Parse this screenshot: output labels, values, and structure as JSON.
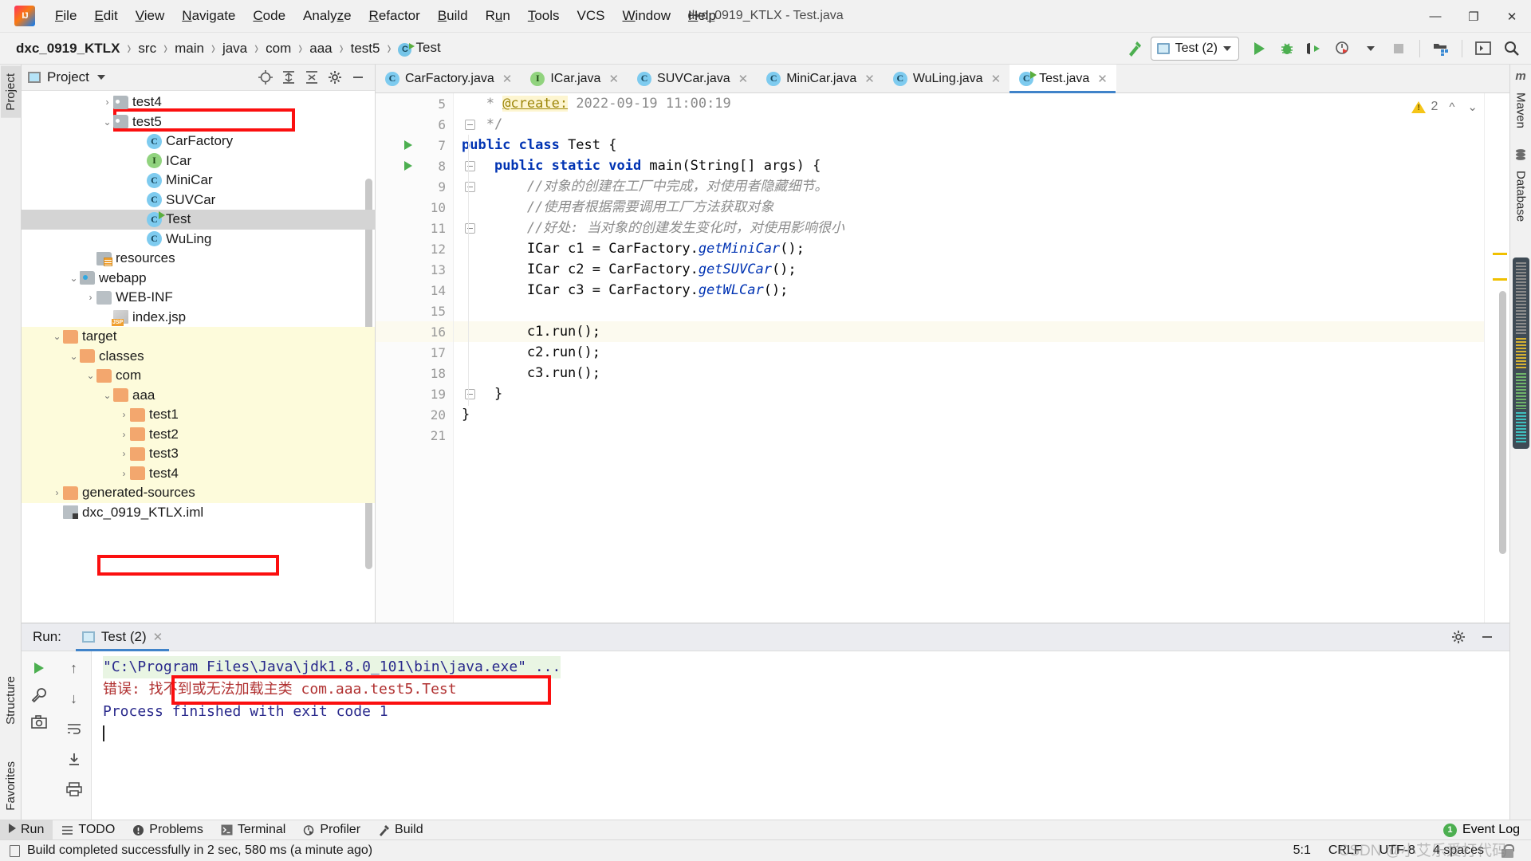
{
  "window": {
    "title": "dxc_0919_KTLX - Test.java",
    "minimize": "—",
    "maximize": "❐",
    "close": "✕"
  },
  "menubar": [
    {
      "label": "File",
      "mnemonic": "F"
    },
    {
      "label": "Edit",
      "mnemonic": "E"
    },
    {
      "label": "View",
      "mnemonic": "V"
    },
    {
      "label": "Navigate",
      "mnemonic": "N"
    },
    {
      "label": "Code",
      "mnemonic": "C"
    },
    {
      "label": "Analyze",
      "mnemonic": "z"
    },
    {
      "label": "Refactor",
      "mnemonic": "R"
    },
    {
      "label": "Build",
      "mnemonic": "B"
    },
    {
      "label": "Run",
      "mnemonic": "u"
    },
    {
      "label": "Tools",
      "mnemonic": "T"
    },
    {
      "label": "VCS",
      "mnemonic": ""
    },
    {
      "label": "Window",
      "mnemonic": "W"
    },
    {
      "label": "Help",
      "mnemonic": "H"
    }
  ],
  "breadcrumb": {
    "items": [
      "dxc_0919_KTLX",
      "src",
      "main",
      "java",
      "com",
      "aaa",
      "test5",
      "Test"
    ],
    "separator": "›",
    "last_icon": "class-icon"
  },
  "toolbar": {
    "build_hammer": "build-icon",
    "run_config": "Test (2)",
    "run": "run-icon",
    "debug": "debug-icon",
    "run_coverage": "run-with-coverage-icon",
    "profile": "profiler-icon",
    "stop": "stop-icon",
    "project_structure": "project-structure-icon",
    "terminal": "terminal-icon",
    "search": "search-everywhere-icon"
  },
  "left_strip": {
    "tabs": [
      {
        "label": "Project",
        "active": true
      },
      {
        "label": "Structure",
        "active": false
      },
      {
        "label": "Favorites",
        "active": false
      }
    ]
  },
  "right_strip": {
    "tabs": [
      {
        "label": "Maven",
        "icon": "maven-icon"
      },
      {
        "label": "Database",
        "icon": "database-icon"
      }
    ]
  },
  "project_panel": {
    "title": "Project",
    "actions": [
      "locate-icon",
      "expand-all-icon",
      "collapse-all-icon",
      "settings-icon",
      "hide-icon"
    ],
    "tree": [
      {
        "label": "test4",
        "indent": 4,
        "arrow": "collapsed",
        "icon": "folder-source",
        "type": "folder"
      },
      {
        "label": "test5",
        "indent": 4,
        "arrow": "expanded",
        "icon": "folder-source",
        "type": "folder",
        "boxed": true
      },
      {
        "label": "CarFactory",
        "indent": 6,
        "arrow": "none",
        "icon": "class",
        "type": "class"
      },
      {
        "label": "ICar",
        "indent": 6,
        "arrow": "none",
        "icon": "interface",
        "type": "interface"
      },
      {
        "label": "MiniCar",
        "indent": 6,
        "arrow": "none",
        "icon": "class",
        "type": "class"
      },
      {
        "label": "SUVCar",
        "indent": 6,
        "arrow": "none",
        "icon": "class",
        "type": "class"
      },
      {
        "label": "Test",
        "indent": 6,
        "arrow": "none",
        "icon": "class-runnable",
        "type": "class",
        "selected": true
      },
      {
        "label": "WuLing",
        "indent": 6,
        "arrow": "none",
        "icon": "class",
        "type": "class"
      },
      {
        "label": "resources",
        "indent": 3,
        "arrow": "none",
        "icon": "folder-resources",
        "type": "folder"
      },
      {
        "label": "webapp",
        "indent": 2,
        "arrow": "expanded",
        "icon": "folder-web",
        "type": "folder"
      },
      {
        "label": "WEB-INF",
        "indent": 3,
        "arrow": "collapsed",
        "icon": "folder-plain",
        "type": "folder"
      },
      {
        "label": "index.jsp",
        "indent": 4,
        "arrow": "none",
        "icon": "jsp",
        "type": "file"
      },
      {
        "label": "target",
        "indent": 1,
        "arrow": "expanded",
        "icon": "folder-excluded",
        "type": "folder",
        "highlight": true
      },
      {
        "label": "classes",
        "indent": 2,
        "arrow": "expanded",
        "icon": "folder-excluded",
        "type": "folder",
        "highlight": true
      },
      {
        "label": "com",
        "indent": 3,
        "arrow": "expanded",
        "icon": "folder-excluded",
        "type": "folder",
        "highlight": true
      },
      {
        "label": "aaa",
        "indent": 4,
        "arrow": "expanded",
        "icon": "folder-excluded",
        "type": "folder",
        "highlight": true
      },
      {
        "label": "test1",
        "indent": 5,
        "arrow": "collapsed",
        "icon": "folder-excluded",
        "type": "folder",
        "highlight": true
      },
      {
        "label": "test2",
        "indent": 5,
        "arrow": "collapsed",
        "icon": "folder-excluded",
        "type": "folder",
        "highlight": true
      },
      {
        "label": "test3",
        "indent": 5,
        "arrow": "collapsed",
        "icon": "folder-excluded",
        "type": "folder",
        "highlight": true
      },
      {
        "label": "test4",
        "indent": 5,
        "arrow": "collapsed",
        "icon": "folder-excluded",
        "type": "folder",
        "highlight": true
      },
      {
        "label": "generated-sources",
        "indent": 1,
        "arrow": "collapsed",
        "icon": "folder-excluded",
        "type": "folder",
        "highlight": true,
        "boxed": true
      },
      {
        "label": "dxc_0919_KTLX.iml",
        "indent": 1,
        "arrow": "none",
        "icon": "iml",
        "type": "file"
      }
    ]
  },
  "editor": {
    "tabs": [
      {
        "label": "CarFactory.java",
        "icon": "class",
        "active": false
      },
      {
        "label": "ICar.java",
        "icon": "interface",
        "active": false
      },
      {
        "label": "SUVCar.java",
        "icon": "class",
        "active": false
      },
      {
        "label": "MiniCar.java",
        "icon": "class",
        "active": false
      },
      {
        "label": "WuLing.java",
        "icon": "class",
        "active": false
      },
      {
        "label": "Test.java",
        "icon": "class-runnable",
        "active": true
      }
    ],
    "warning_count": "2",
    "lines": [
      {
        "no": "5",
        "tokens": [
          {
            "t": "cmjd",
            "v": "   * "
          },
          {
            "t": "tag-at",
            "v": "@create:"
          },
          {
            "t": "cmjd",
            "v": " 2022-09-19 11:00:19"
          }
        ],
        "run": false,
        "fold": false,
        "current": false
      },
      {
        "no": "6",
        "tokens": [
          {
            "t": "cmjd",
            "v": "   */"
          }
        ],
        "run": false,
        "fold": true,
        "current": false
      },
      {
        "no": "7",
        "tokens": [
          {
            "t": "kw",
            "v": "public class "
          },
          {
            "t": "plain",
            "v": "Test {"
          }
        ],
        "run": true,
        "fold": false,
        "current": false
      },
      {
        "no": "8",
        "tokens": [
          {
            "t": "plain",
            "v": "    "
          },
          {
            "t": "kw",
            "v": "public static void "
          },
          {
            "t": "plain",
            "v": "main(String[] args) {"
          }
        ],
        "run": true,
        "fold": true,
        "current": false
      },
      {
        "no": "9",
        "tokens": [
          {
            "t": "cm",
            "v": "        //对象的创建在工厂中完成，对使用者隐藏细节。"
          }
        ],
        "run": false,
        "fold": true,
        "current": false
      },
      {
        "no": "10",
        "tokens": [
          {
            "t": "cm",
            "v": "        //使用者根据需要调用工厂方法获取对象"
          }
        ],
        "run": false,
        "fold": false,
        "current": false
      },
      {
        "no": "11",
        "tokens": [
          {
            "t": "cm",
            "v": "        //好处: 当对象的创建发生变化时，对使用影响很小"
          }
        ],
        "run": false,
        "fold": true,
        "current": false
      },
      {
        "no": "12",
        "tokens": [
          {
            "t": "plain",
            "v": "        ICar c1 = CarFactory."
          },
          {
            "t": "mi",
            "v": "getMiniCar"
          },
          {
            "t": "plain",
            "v": "();"
          }
        ],
        "run": false,
        "fold": false,
        "current": false
      },
      {
        "no": "13",
        "tokens": [
          {
            "t": "plain",
            "v": "        ICar c2 = CarFactory."
          },
          {
            "t": "mi",
            "v": "getSUVCar"
          },
          {
            "t": "plain",
            "v": "();"
          }
        ],
        "run": false,
        "fold": false,
        "current": false
      },
      {
        "no": "14",
        "tokens": [
          {
            "t": "plain",
            "v": "        ICar c3 = CarFactory."
          },
          {
            "t": "mi",
            "v": "getWLCar"
          },
          {
            "t": "plain",
            "v": "();"
          }
        ],
        "run": false,
        "fold": false,
        "current": false
      },
      {
        "no": "15",
        "tokens": [
          {
            "t": "plain",
            "v": ""
          }
        ],
        "run": false,
        "fold": false,
        "current": false
      },
      {
        "no": "16",
        "tokens": [
          {
            "t": "plain",
            "v": "        c1.run();"
          }
        ],
        "run": false,
        "fold": false,
        "current": true
      },
      {
        "no": "17",
        "tokens": [
          {
            "t": "plain",
            "v": "        c2.run();"
          }
        ],
        "run": false,
        "fold": false,
        "current": false
      },
      {
        "no": "18",
        "tokens": [
          {
            "t": "plain",
            "v": "        c3.run();"
          }
        ],
        "run": false,
        "fold": false,
        "current": false
      },
      {
        "no": "19",
        "tokens": [
          {
            "t": "plain",
            "v": "    }"
          }
        ],
        "run": false,
        "fold": true,
        "current": false
      },
      {
        "no": "20",
        "tokens": [
          {
            "t": "plain",
            "v": "}"
          }
        ],
        "run": false,
        "fold": false,
        "current": false
      },
      {
        "no": "21",
        "tokens": [
          {
            "t": "plain",
            "v": ""
          }
        ],
        "run": false,
        "fold": false,
        "current": false
      }
    ]
  },
  "run_panel": {
    "label": "Run:",
    "tab": "Test (2)",
    "close": "✕",
    "actions": [
      "settings-icon",
      "hide-icon"
    ],
    "toolbar": [
      "rerun-icon",
      "wrench-icon",
      "camera-icon"
    ],
    "toolbar2": [
      "scroll-up-icon",
      "scroll-down-icon",
      "soft-wrap-icon",
      "scroll-to-end-icon",
      "print-icon"
    ],
    "console": [
      {
        "text": "\"C:\\Program Files\\Java\\jdk1.8.0_101\\bin\\java.exe\" ...",
        "style": "cmd"
      },
      {
        "text": "错误: 找不到或无法加载主类 com.aaa.test5.Test",
        "style": "err",
        "boxed": true
      },
      {
        "text": "",
        "style": "plain"
      },
      {
        "text": "Process finished with exit code 1",
        "style": "done"
      }
    ]
  },
  "bottom_bar": {
    "items": [
      {
        "label": "Run",
        "icon": "run-icon",
        "active": true
      },
      {
        "label": "TODO",
        "icon": "todo-icon",
        "active": false
      },
      {
        "label": "Problems",
        "icon": "problems-icon",
        "active": false
      },
      {
        "label": "Terminal",
        "icon": "terminal-icon",
        "active": false
      },
      {
        "label": "Profiler",
        "icon": "profiler-icon",
        "active": false
      },
      {
        "label": "Build",
        "icon": "build-icon",
        "active": false
      }
    ],
    "event_log": {
      "label": "Event Log",
      "count": "1"
    }
  },
  "status_bar": {
    "message": "Build completed successfully in 2 sec, 580 ms (a minute ago)",
    "caret": "5:1",
    "line_separator": "CRLF",
    "encoding": "UTF-8",
    "indent": "4 spaces",
    "lock": "read-only-icon",
    "watermark": "CSDN @小艾乐爱打代码"
  }
}
